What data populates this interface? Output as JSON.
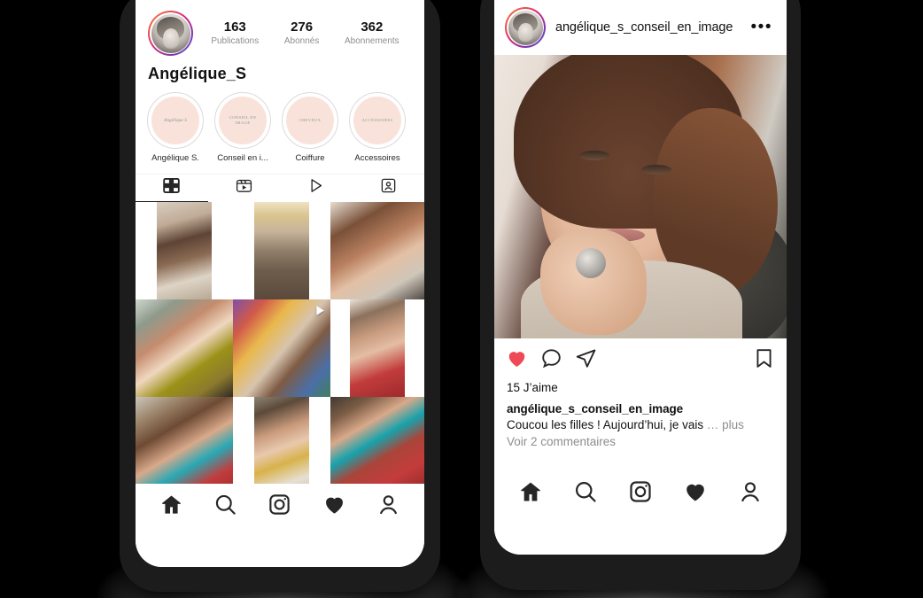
{
  "background_color": "#000000",
  "left_phone": {
    "name": "instagram-profile-screen",
    "profile": {
      "avatar_alt": "profile-photo",
      "display_name": "Angélique_S",
      "stats": [
        {
          "number": "163",
          "label": "Publications"
        },
        {
          "number": "276",
          "label": "Abonnés"
        },
        {
          "number": "362",
          "label": "Abonnements"
        }
      ]
    },
    "highlights": [
      {
        "label": "Angélique S.",
        "cover_text": "Angélique S",
        "script": true
      },
      {
        "label": "Conseil en i...",
        "cover_text": "CONSEIL EN IMAGE",
        "script": false
      },
      {
        "label": "Coiffure",
        "cover_text": "CHEVEUX",
        "script": false
      },
      {
        "label": "Accessoires",
        "cover_text": "ACCESSOIRES",
        "script": false
      }
    ],
    "highlight_cover_color": "#f9e2da",
    "tabs": [
      {
        "icon": "grid-icon",
        "active": true
      },
      {
        "icon": "reels-icon",
        "active": false
      },
      {
        "icon": "igtv-play-icon",
        "active": false
      },
      {
        "icon": "tagged-icon",
        "active": false
      }
    ],
    "grid_posts": [
      {
        "id": "post-1",
        "multi": false,
        "video": false
      },
      {
        "id": "post-2",
        "multi": false,
        "video": false
      },
      {
        "id": "post-3",
        "multi": false,
        "video": false
      },
      {
        "id": "post-4",
        "multi": false,
        "video": false
      },
      {
        "id": "post-5",
        "multi": false,
        "video": true
      },
      {
        "id": "post-6",
        "multi": false,
        "video": false
      },
      {
        "id": "post-7",
        "multi": false,
        "video": false
      },
      {
        "id": "post-8",
        "multi": false,
        "video": false
      },
      {
        "id": "post-9",
        "multi": false,
        "video": false
      },
      {
        "id": "post-10",
        "multi": false,
        "video": false
      },
      {
        "id": "post-11",
        "multi": true,
        "video": false
      },
      {
        "id": "post-12",
        "multi": true,
        "video": false
      }
    ],
    "bottom_nav": [
      {
        "icon": "home-icon",
        "active": true
      },
      {
        "icon": "search-icon",
        "active": false
      },
      {
        "icon": "camera-icon",
        "active": false
      },
      {
        "icon": "heart-icon",
        "active": true
      },
      {
        "icon": "profile-icon",
        "active": false
      }
    ]
  },
  "right_phone": {
    "name": "instagram-post-screen",
    "post_header": {
      "avatar_alt": "profile-photo",
      "username": "angélique_s_conseil_en_image",
      "menu": "•••"
    },
    "post_image_alt": "portrait-photo",
    "actions": {
      "like": "heart-icon",
      "like_color": "#ed4956",
      "comment": "comment-icon",
      "share": "share-icon",
      "save": "bookmark-icon"
    },
    "likes": "15 J’aime",
    "caption": {
      "username": "angélique_s_conseil_en_image",
      "text": "Coucou les filles ! Aujourd’hui, je vais",
      "ellipsis": "…",
      "more": "plus"
    },
    "comments_link": "Voir 2 commentaires",
    "bottom_nav": [
      {
        "icon": "home-icon",
        "active": true
      },
      {
        "icon": "search-icon",
        "active": false
      },
      {
        "icon": "camera-icon",
        "active": false
      },
      {
        "icon": "heart-icon",
        "active": true
      },
      {
        "icon": "profile-icon",
        "active": false
      }
    ]
  }
}
